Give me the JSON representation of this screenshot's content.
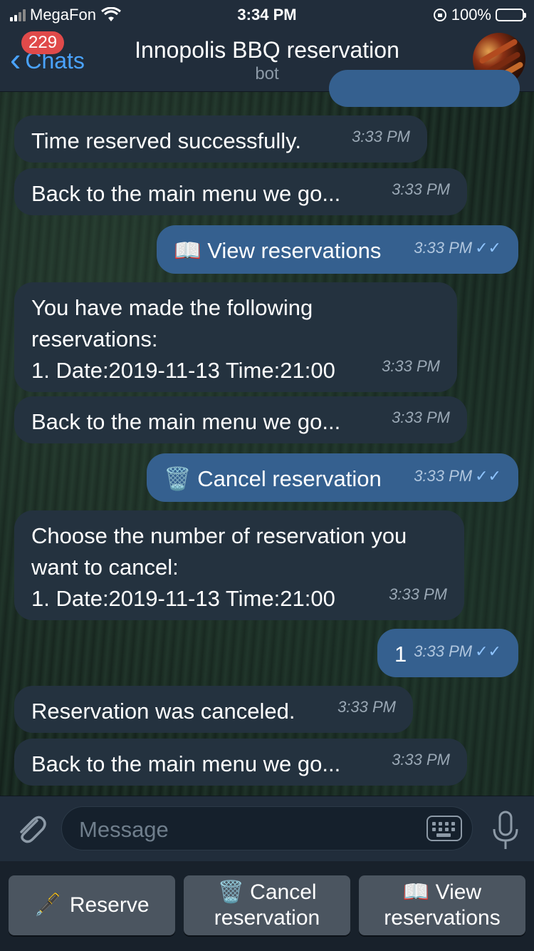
{
  "status_bar": {
    "carrier": "MegaFon",
    "time": "3:34 PM",
    "battery": "100%",
    "signal_icon": "signal-bars-icon",
    "wifi_icon": "wifi-icon"
  },
  "header": {
    "back_label": "Chats",
    "unread_count": "229",
    "title": "Innopolis BBQ reservation",
    "subtitle": "bot",
    "avatar_icon": "bbq-avatar"
  },
  "messages": [
    {
      "dir": "in",
      "text": "Time reserved successfully.",
      "time": "3:33 PM"
    },
    {
      "dir": "in",
      "text": "Back to the main menu we go...",
      "time": "3:33 PM"
    },
    {
      "dir": "out",
      "emoji": "📖",
      "text": "View reservations",
      "time": "3:33 PM",
      "status": "✓✓"
    },
    {
      "dir": "in",
      "lines": [
        "You have made the following",
        "reservations:",
        "1. Date:2019-11-13 Time:21:00"
      ],
      "time": "3:33 PM"
    },
    {
      "dir": "in",
      "text": "Back to the main menu we go...",
      "time": "3:33 PM"
    },
    {
      "dir": "out",
      "emoji": "🗑️",
      "text": "Cancel reservation",
      "time": "3:33 PM",
      "status": "✓✓"
    },
    {
      "dir": "in",
      "lines": [
        "Choose the number of reservation you",
        "want to cancel:",
        "1. Date:2019-11-13 Time:21:00"
      ],
      "time": "3:33 PM"
    },
    {
      "dir": "out",
      "text": "1",
      "time": "3:33 PM",
      "status": "✓✓"
    },
    {
      "dir": "in",
      "text": "Reservation was canceled.",
      "time": "3:33 PM"
    },
    {
      "dir": "in",
      "text": "Back to the main menu we go...",
      "time": "3:33 PM"
    }
  ],
  "composer": {
    "placeholder": "Message",
    "attach_icon": "paperclip-icon",
    "keyboard_icon": "keyboard-icon",
    "mic_icon": "microphone-icon"
  },
  "keyboard": {
    "reserve": {
      "emoji": "🖋️",
      "label": "Reserve"
    },
    "cancel": {
      "emoji": "🗑️",
      "label_line1": "Cancel",
      "label_line2": "reservation"
    },
    "view": {
      "emoji": "📖",
      "label_line1": "View",
      "label_line2": "reservations"
    }
  }
}
